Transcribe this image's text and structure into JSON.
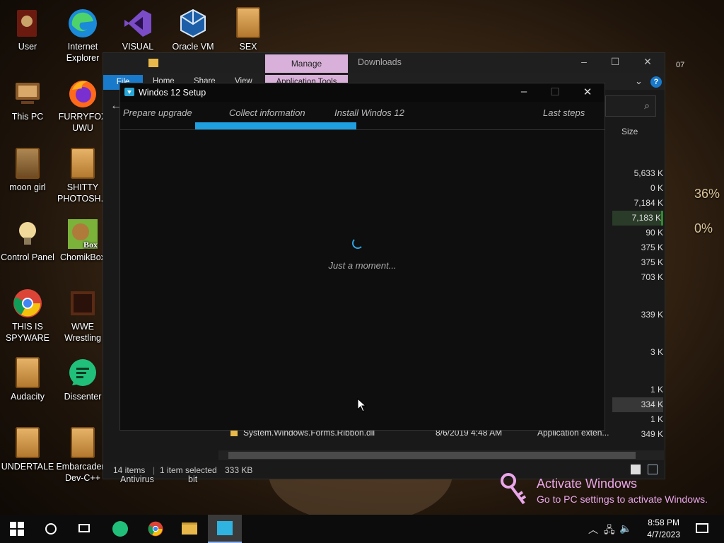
{
  "desktop": {
    "icons": [
      {
        "label": "User"
      },
      {
        "label": "Internet Explorer"
      },
      {
        "label": "VISUAL"
      },
      {
        "label": "Oracle VM"
      },
      {
        "label": "SEX"
      },
      {
        "label": "This PC"
      },
      {
        "label": "FURRYFOX UWU"
      },
      {
        "label": "moon girl"
      },
      {
        "label": "SHITTY PHOTOSH..."
      },
      {
        "label": "Control Panel"
      },
      {
        "label": "ChomikBox"
      },
      {
        "label": "THIS IS SPYWARE"
      },
      {
        "label": "WWE Wrestling"
      },
      {
        "label": "Audacity"
      },
      {
        "label": "Dissenter"
      },
      {
        "label": "UNDERTALE"
      },
      {
        "label": "Embarcadero Dev-C++"
      }
    ],
    "behind_labels": {
      "antivirus": "Antivirus",
      "bit": "bit",
      "num": "07"
    },
    "meter_percent": "36%",
    "meter_percent2": "0%"
  },
  "explorer": {
    "context_tab": "Manage",
    "downloads": "Downloads",
    "ribbon": {
      "file": "File",
      "home": "Home",
      "share": "Share",
      "view": "View",
      "app_tools": "Application Tools"
    },
    "column_size": "Size",
    "sizes": [
      "5,633 K",
      "0 K",
      "7,184 K",
      "7,183 K",
      "90 K",
      "375 K",
      "375 K",
      "703 K",
      "339 K",
      "3 K",
      "1 K",
      "334 K",
      "1 K",
      "349 K"
    ],
    "visible_row": {
      "name": "System.Windows.Forms.Ribbon.dll",
      "date": "8/6/2019 4:48 AM",
      "type": "Application exten..."
    },
    "status": {
      "items": "14 items",
      "selected": "1 item selected",
      "size": "333 KB"
    }
  },
  "setup": {
    "title": "Windos 12 Setup",
    "steps": [
      "Prepare upgrade",
      "Collect information",
      "Install Windos 12",
      "Last steps"
    ],
    "progress": 0.33,
    "message": "Just a moment..."
  },
  "watermark": {
    "line1": "Activate Windows",
    "line2": "Go to PC settings to activate Windows."
  },
  "taskbar": {
    "time": "8:58 PM",
    "date": "4/7/2023"
  },
  "colors": {
    "accent": "#1e9fe0",
    "manage_tab": "#d9b0d9",
    "watermark": "#e9a6e9"
  }
}
